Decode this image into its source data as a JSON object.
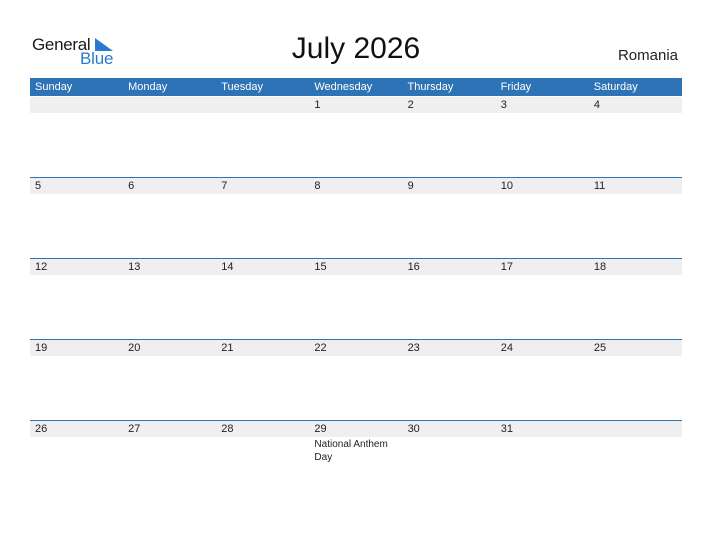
{
  "logo": {
    "general": "General",
    "blue": "Blue",
    "icon": "triangle-flag-icon"
  },
  "title": "July 2026",
  "country": "Romania",
  "weekdays": [
    "Sunday",
    "Monday",
    "Tuesday",
    "Wednesday",
    "Thursday",
    "Friday",
    "Saturday"
  ],
  "weeks": [
    [
      {
        "day": ""
      },
      {
        "day": ""
      },
      {
        "day": ""
      },
      {
        "day": "1"
      },
      {
        "day": "2"
      },
      {
        "day": "3"
      },
      {
        "day": "4"
      }
    ],
    [
      {
        "day": "5"
      },
      {
        "day": "6"
      },
      {
        "day": "7"
      },
      {
        "day": "8"
      },
      {
        "day": "9"
      },
      {
        "day": "10"
      },
      {
        "day": "11"
      }
    ],
    [
      {
        "day": "12"
      },
      {
        "day": "13"
      },
      {
        "day": "14"
      },
      {
        "day": "15"
      },
      {
        "day": "16"
      },
      {
        "day": "17"
      },
      {
        "day": "18"
      }
    ],
    [
      {
        "day": "19"
      },
      {
        "day": "20"
      },
      {
        "day": "21"
      },
      {
        "day": "22"
      },
      {
        "day": "23"
      },
      {
        "day": "24"
      },
      {
        "day": "25"
      }
    ],
    [
      {
        "day": "26"
      },
      {
        "day": "27"
      },
      {
        "day": "28"
      },
      {
        "day": "29",
        "event": "National Anthem Day"
      },
      {
        "day": "30"
      },
      {
        "day": "31"
      },
      {
        "day": ""
      }
    ]
  ],
  "colors": {
    "accent": "#2e73b5",
    "logo_blue": "#2a7bd0",
    "strip": "#efefef"
  }
}
